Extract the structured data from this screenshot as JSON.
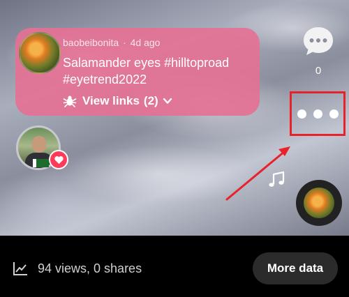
{
  "comment": {
    "username": "baobeibonita",
    "separator": "·",
    "time_ago": "4d ago",
    "text": "Salamander eyes #hilltoproad #eyetrend2022",
    "view_links_label": "View links",
    "view_links_count": "(2)"
  },
  "actions": {
    "comment_count": "0"
  },
  "footer": {
    "stats_text": "94 views, 0 shares",
    "more_data_label": "More data"
  },
  "colors": {
    "card_pink": "#e67094",
    "highlight_red": "#e8222a",
    "heart_red": "#ff3b5c"
  }
}
